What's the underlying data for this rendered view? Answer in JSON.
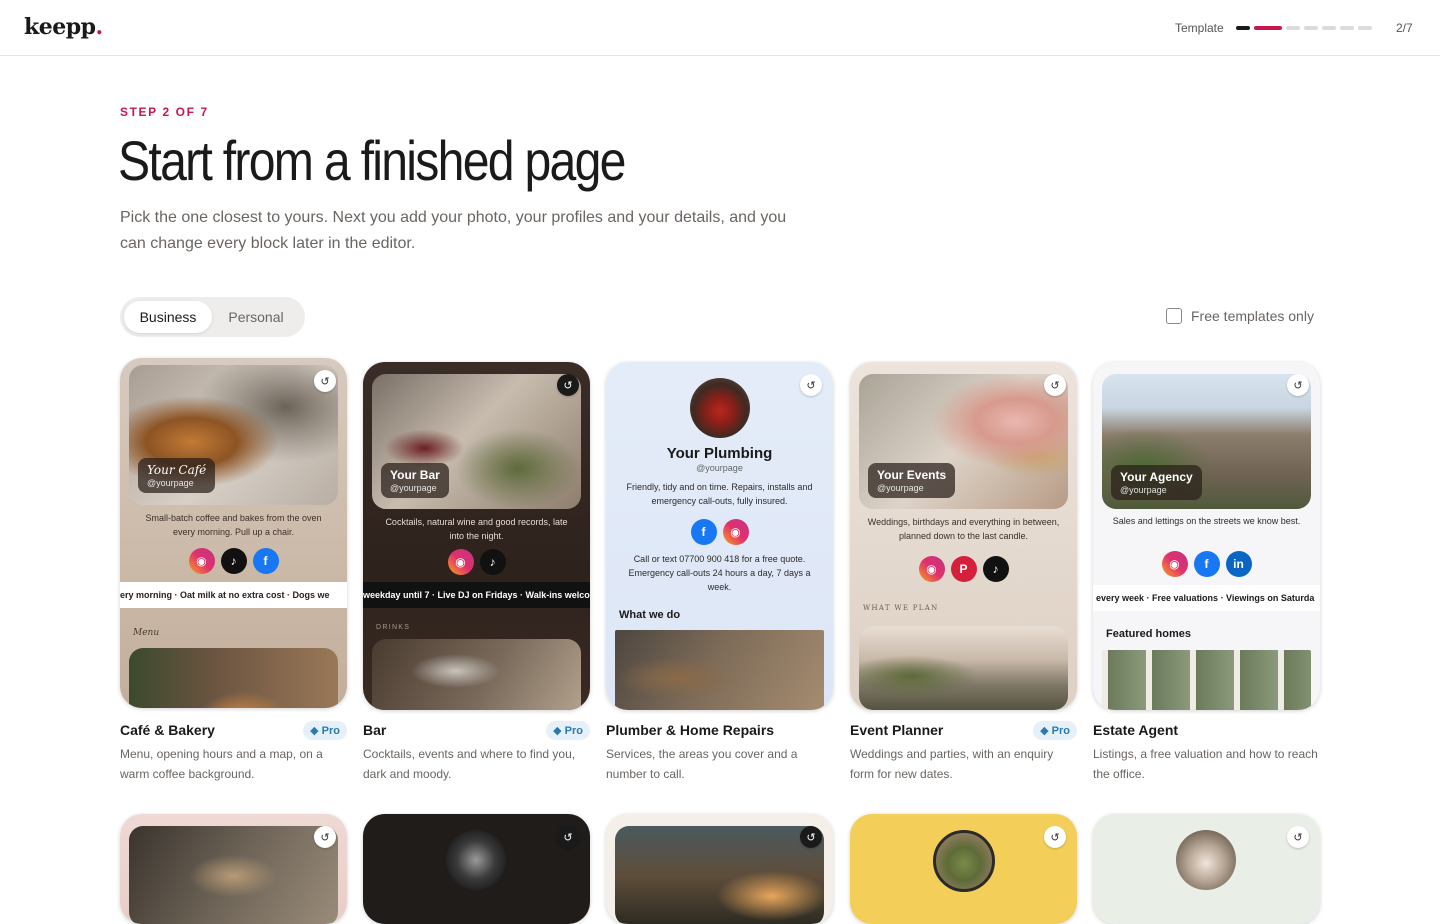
{
  "header": {
    "logo": "keepp",
    "logo_dot": ".",
    "progress_label": "Template",
    "step_count": "2/7"
  },
  "intro": {
    "eyebrow": "STEP 2 OF 7",
    "title": "Start from a finished page",
    "subtitle": "Pick the one closest to yours. Next you add your photo, your profiles and your details, and you can change every block later in the editor."
  },
  "tabs": [
    {
      "label": "Business",
      "active": true
    },
    {
      "label": "Personal",
      "active": false
    }
  ],
  "filter": {
    "label": "Free templates only",
    "checked": false
  },
  "icons": {
    "share": "share-icon",
    "pro": "gem-icon"
  },
  "colors": {
    "accent": "#c8174c",
    "pro_bg": "#e5f0f8",
    "pro_text": "#2a7ab0"
  },
  "templates": [
    {
      "title": "Café & Bakery",
      "pro": "Pro",
      "desc": "Menu, opening hours and a map, on a warm coffee background.",
      "preview": {
        "name": "Your Café",
        "handle": "@yourpage",
        "bio": "Small-batch coffee and bakes from the oven every morning. Pull up a chair.",
        "ticker": "ery morning · Oat milk at no extra cost · Dogs we",
        "section": "Menu"
      }
    },
    {
      "title": "Bar",
      "pro": "Pro",
      "desc": "Cocktails, events and where to find you, dark and moody.",
      "preview": {
        "name": "Your Bar",
        "handle": "@yourpage",
        "bio": "Cocktails, natural wine and good records, late into the night.",
        "ticker": "weekday until 7 · Live DJ on Fridays · Walk-ins welco",
        "section": "DRINKS"
      }
    },
    {
      "title": "Plumber & Home Repairs",
      "pro": "",
      "desc": "Services, the areas you cover and a number to call.",
      "preview": {
        "name": "Your Plumbing",
        "handle": "@yourpage",
        "bio": "Friendly, tidy and on time. Repairs, installs and emergency call-outs, fully insured.",
        "bio2": "Call or text 07700 900 418 for a free quote. Emergency call-outs 24 hours a day, 7 days a week.",
        "section": "What we do"
      }
    },
    {
      "title": "Event Planner",
      "pro": "Pro",
      "desc": "Weddings and parties, with an enquiry form for new dates.",
      "preview": {
        "name": "Your Events",
        "handle": "@yourpage",
        "bio": "Weddings, birthdays and everything in between, planned down to the last candle.",
        "section": "WHAT WE PLAN"
      }
    },
    {
      "title": "Estate Agent",
      "pro": "",
      "desc": "Listings, a free valuation and how to reach the office.",
      "preview": {
        "name": "Your Agency",
        "handle": "@yourpage",
        "bio": "Sales and lettings on the streets we know best.",
        "ticker": "every week · Free valuations · Viewings on Saturda",
        "section": "Featured homes"
      }
    }
  ]
}
